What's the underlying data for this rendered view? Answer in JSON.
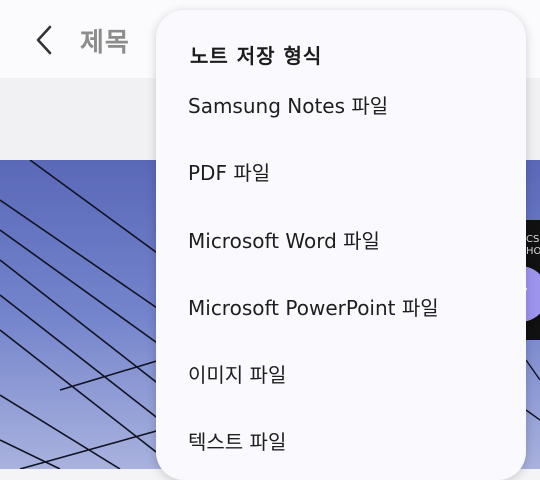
{
  "app": {
    "title": "제목"
  },
  "icons": {
    "back": "chevron-left-icon",
    "pen": "pen-icon"
  },
  "colors": {
    "accent": "#9d94ee",
    "menu_background": "#fafafe",
    "title_text": "#8c8c8c"
  },
  "menu": {
    "header": "노트 저장 형식",
    "items": [
      {
        "label": "Samsung Notes 파일"
      },
      {
        "label": "PDF 파일"
      },
      {
        "label": "Microsoft Word 파일"
      },
      {
        "label": "Microsoft PowerPoint 파일"
      },
      {
        "label": "이미지 파일"
      },
      {
        "label": "텍스트 파일"
      }
    ]
  }
}
